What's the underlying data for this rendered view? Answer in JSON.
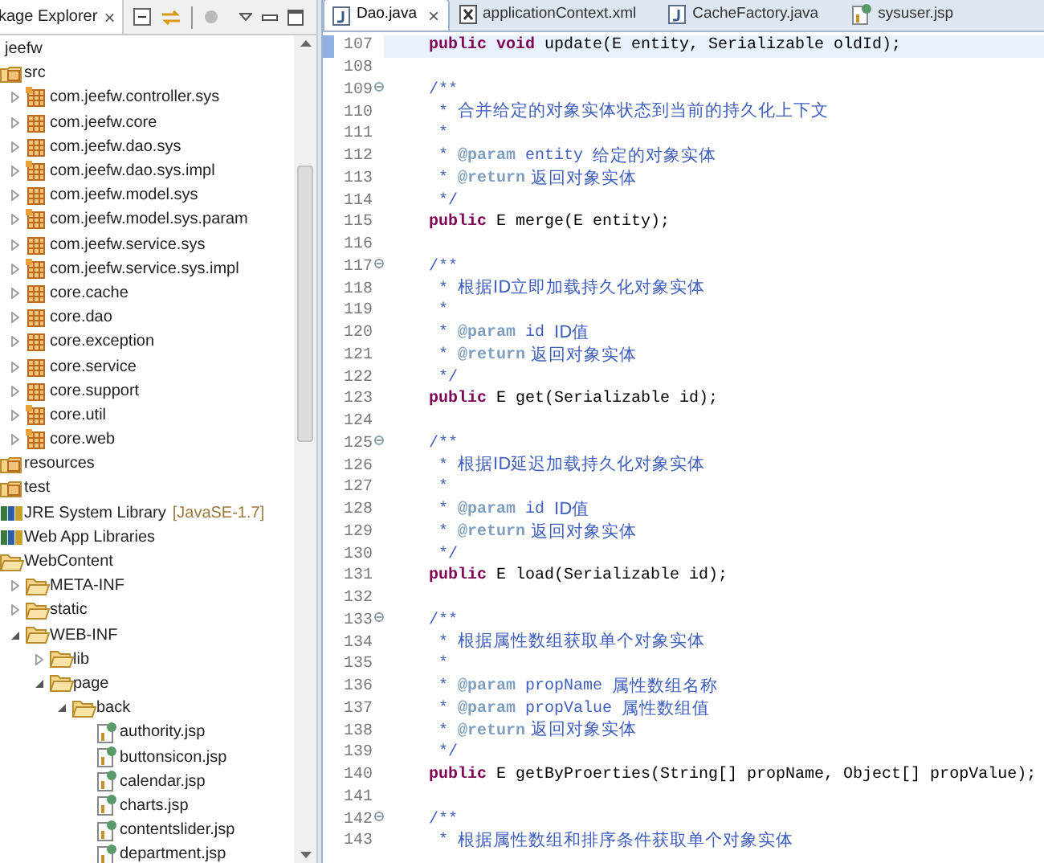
{
  "explorer": {
    "title": "kage Explorer",
    "close": "×"
  },
  "tree": [
    {
      "label": "jeefw",
      "children": [
        {
          "label": "src",
          "kind": "source-folder",
          "children": [
            {
              "label": "com.jeefw.controller.sys",
              "kind": "package-decorated",
              "expanded": false
            },
            {
              "label": "com.jeefw.core",
              "kind": "package",
              "expanded": false
            },
            {
              "label": "com.jeefw.dao.sys",
              "kind": "package",
              "expanded": false
            },
            {
              "label": "com.jeefw.dao.sys.impl",
              "kind": "package-decorated",
              "expanded": false
            },
            {
              "label": "com.jeefw.model.sys",
              "kind": "package",
              "expanded": false
            },
            {
              "label": "com.jeefw.model.sys.param",
              "kind": "package-decorated",
              "expanded": false
            },
            {
              "label": "com.jeefw.service.sys",
              "kind": "package",
              "expanded": false
            },
            {
              "label": "com.jeefw.service.sys.impl",
              "kind": "package-decorated",
              "expanded": false
            },
            {
              "label": "core.cache",
              "kind": "package",
              "expanded": false
            },
            {
              "label": "core.dao",
              "kind": "package",
              "expanded": false
            },
            {
              "label": "core.exception",
              "kind": "package",
              "expanded": false
            },
            {
              "label": "core.service",
              "kind": "package",
              "expanded": false
            },
            {
              "label": "core.support",
              "kind": "package",
              "expanded": false
            },
            {
              "label": "core.util",
              "kind": "package-decorated",
              "expanded": false
            },
            {
              "label": "core.web",
              "kind": "package-decorated",
              "expanded": false
            }
          ]
        },
        {
          "label": "resources",
          "kind": "source-folder"
        },
        {
          "label": "test",
          "kind": "source-folder"
        },
        {
          "label": "JRE System Library",
          "decoration": "[JavaSE-1.7]",
          "kind": "library"
        },
        {
          "label": "Web App Libraries",
          "kind": "library"
        },
        {
          "label": "WebContent",
          "kind": "folder",
          "children": [
            {
              "label": "META-INF",
              "kind": "folder",
              "expanded": false
            },
            {
              "label": "static",
              "kind": "folder",
              "expanded": false
            },
            {
              "label": "WEB-INF",
              "kind": "folder",
              "expanded": true,
              "children": [
                {
                  "label": "lib",
                  "kind": "folder",
                  "expanded": false
                },
                {
                  "label": "page",
                  "kind": "folder",
                  "expanded": true,
                  "children": [
                    {
                      "label": "back",
                      "kind": "folder",
                      "expanded": true,
                      "children": [
                        {
                          "label": "authority.jsp",
                          "kind": "jsp"
                        },
                        {
                          "label": "buttonsicon.jsp",
                          "kind": "jsp"
                        },
                        {
                          "label": "calendar.jsp",
                          "kind": "jsp"
                        },
                        {
                          "label": "charts.jsp",
                          "kind": "jsp"
                        },
                        {
                          "label": "contentslider.jsp",
                          "kind": "jsp"
                        },
                        {
                          "label": "department.jsp",
                          "kind": "jsp"
                        }
                      ]
                    }
                  ]
                }
              ]
            }
          ]
        }
      ]
    }
  ],
  "tabs": [
    {
      "label": "Dao.java",
      "kind": "java",
      "selected": true,
      "close": "×"
    },
    {
      "label": "applicationContext.xml",
      "kind": "xml",
      "selected": false
    },
    {
      "label": "CacheFactory.java",
      "kind": "java",
      "selected": false
    },
    {
      "label": "sysuser.jsp",
      "kind": "jsp",
      "selected": false
    }
  ],
  "lines": [
    {
      "number": "107",
      "current": true,
      "fold": false,
      "segments": [
        {
          "kind": "keyword",
          "text": "public void"
        },
        {
          "kind": "code",
          "text": " update(E entity, Serializable oldId);"
        }
      ]
    },
    {
      "number": "108",
      "current": false,
      "fold": false
    },
    {
      "number": "109",
      "current": false,
      "fold": true,
      "segments": [
        {
          "kind": "comment",
          "text": "/**"
        }
      ]
    },
    {
      "number": "110",
      "current": false,
      "fold": false,
      "segments": [
        {
          "kind": "comment",
          "text": " * "
        },
        {
          "kind": "comment-text",
          "text": "合并给定的对象实体状态到当前的持久化上下文"
        }
      ]
    },
    {
      "number": "111",
      "current": false,
      "fold": false,
      "segments": [
        {
          "kind": "comment",
          "text": " *"
        }
      ]
    },
    {
      "number": "112",
      "current": false,
      "fold": false,
      "segments": [
        {
          "kind": "comment",
          "text": " * "
        },
        {
          "kind": "tag",
          "text": "@param"
        },
        {
          "kind": "comment",
          "text": " entity "
        },
        {
          "kind": "comment-text",
          "text": "给定的对象实体"
        }
      ]
    },
    {
      "number": "113",
      "current": false,
      "fold": false,
      "segments": [
        {
          "kind": "comment",
          "text": " * "
        },
        {
          "kind": "tag",
          "text": "@return"
        },
        {
          "kind": "comment-text",
          "text": " 返回对象实体"
        }
      ]
    },
    {
      "number": "114",
      "current": false,
      "fold": false,
      "segments": [
        {
          "kind": "comment",
          "text": " */"
        }
      ]
    },
    {
      "number": "115",
      "current": false,
      "fold": false,
      "segments": [
        {
          "kind": "keyword",
          "text": "public"
        },
        {
          "kind": "code",
          "text": " E merge(E entity);"
        }
      ]
    },
    {
      "number": "116",
      "current": false,
      "fold": false
    },
    {
      "number": "117",
      "current": false,
      "fold": true,
      "segments": [
        {
          "kind": "comment",
          "text": "/**"
        }
      ]
    },
    {
      "number": "118",
      "current": false,
      "fold": false,
      "segments": [
        {
          "kind": "comment",
          "text": " * "
        },
        {
          "kind": "comment-text",
          "text": "根据ID立即加载持久化对象实体"
        }
      ]
    },
    {
      "number": "119",
      "current": false,
      "fold": false,
      "segments": [
        {
          "kind": "comment",
          "text": " *"
        }
      ]
    },
    {
      "number": "120",
      "current": false,
      "fold": false,
      "segments": [
        {
          "kind": "comment",
          "text": " * "
        },
        {
          "kind": "tag",
          "text": "@param"
        },
        {
          "kind": "comment",
          "text": " id "
        },
        {
          "kind": "comment-text",
          "text": "ID值"
        }
      ]
    },
    {
      "number": "121",
      "current": false,
      "fold": false,
      "segments": [
        {
          "kind": "comment",
          "text": " * "
        },
        {
          "kind": "tag",
          "text": "@return"
        },
        {
          "kind": "comment-text",
          "text": " 返回对象实体"
        }
      ]
    },
    {
      "number": "122",
      "current": false,
      "fold": false,
      "segments": [
        {
          "kind": "comment",
          "text": " */"
        }
      ]
    },
    {
      "number": "123",
      "current": false,
      "fold": false,
      "segments": [
        {
          "kind": "keyword",
          "text": "public"
        },
        {
          "kind": "code",
          "text": " E get(Serializable id);"
        }
      ]
    },
    {
      "number": "124",
      "current": false,
      "fold": false
    },
    {
      "number": "125",
      "current": false,
      "fold": true,
      "segments": [
        {
          "kind": "comment",
          "text": "/**"
        }
      ]
    },
    {
      "number": "126",
      "current": false,
      "fold": false,
      "segments": [
        {
          "kind": "comment",
          "text": " * "
        },
        {
          "kind": "comment-text",
          "text": "根据ID延迟加载持久化对象实体"
        }
      ]
    },
    {
      "number": "127",
      "current": false,
      "fold": false,
      "segments": [
        {
          "kind": "comment",
          "text": " *"
        }
      ]
    },
    {
      "number": "128",
      "current": false,
      "fold": false,
      "segments": [
        {
          "kind": "comment",
          "text": " * "
        },
        {
          "kind": "tag",
          "text": "@param"
        },
        {
          "kind": "comment",
          "text": " id "
        },
        {
          "kind": "comment-text",
          "text": "ID值"
        }
      ]
    },
    {
      "number": "129",
      "current": false,
      "fold": false,
      "segments": [
        {
          "kind": "comment",
          "text": " * "
        },
        {
          "kind": "tag",
          "text": "@return"
        },
        {
          "kind": "comment-text",
          "text": " 返回对象实体"
        }
      ]
    },
    {
      "number": "130",
      "current": false,
      "fold": false,
      "segments": [
        {
          "kind": "comment",
          "text": " */"
        }
      ]
    },
    {
      "number": "131",
      "current": false,
      "fold": false,
      "segments": [
        {
          "kind": "keyword",
          "text": "public"
        },
        {
          "kind": "code",
          "text": " E load(Serializable id);"
        }
      ]
    },
    {
      "number": "132",
      "current": false,
      "fold": false
    },
    {
      "number": "133",
      "current": false,
      "fold": true,
      "segments": [
        {
          "kind": "comment",
          "text": "/**"
        }
      ]
    },
    {
      "number": "134",
      "current": false,
      "fold": false,
      "segments": [
        {
          "kind": "comment",
          "text": " * "
        },
        {
          "kind": "comment-text",
          "text": "根据属性数组获取单个对象实体"
        }
      ]
    },
    {
      "number": "135",
      "current": false,
      "fold": false,
      "segments": [
        {
          "kind": "comment",
          "text": " *"
        }
      ]
    },
    {
      "number": "136",
      "current": false,
      "fold": false,
      "segments": [
        {
          "kind": "comment",
          "text": " * "
        },
        {
          "kind": "tag",
          "text": "@param"
        },
        {
          "kind": "comment",
          "text": " propName "
        },
        {
          "kind": "comment-text",
          "text": "属性数组名称"
        }
      ]
    },
    {
      "number": "137",
      "current": false,
      "fold": false,
      "segments": [
        {
          "kind": "comment",
          "text": " * "
        },
        {
          "kind": "tag",
          "text": "@param"
        },
        {
          "kind": "comment",
          "text": " propValue "
        },
        {
          "kind": "comment-text",
          "text": "属性数组值"
        }
      ]
    },
    {
      "number": "138",
      "current": false,
      "fold": false,
      "segments": [
        {
          "kind": "comment",
          "text": " * "
        },
        {
          "kind": "tag",
          "text": "@return"
        },
        {
          "kind": "comment-text",
          "text": " 返回对象实体"
        }
      ]
    },
    {
      "number": "139",
      "current": false,
      "fold": false,
      "segments": [
        {
          "kind": "comment",
          "text": " */"
        }
      ]
    },
    {
      "number": "140",
      "current": false,
      "fold": false,
      "segments": [
        {
          "kind": "keyword",
          "text": "public"
        },
        {
          "kind": "code",
          "text": " E getByProerties(String[] propName, Object[] propValue);"
        }
      ]
    },
    {
      "number": "141",
      "current": false,
      "fold": false
    },
    {
      "number": "142",
      "current": false,
      "fold": true,
      "segments": [
        {
          "kind": "comment",
          "text": "/**"
        }
      ]
    },
    {
      "number": "143",
      "current": false,
      "fold": false,
      "segments": [
        {
          "kind": "comment",
          "text": " * "
        },
        {
          "kind": "comment-text",
          "text": "根据属性数组和排序条件获取单个对象实体"
        }
      ]
    }
  ]
}
